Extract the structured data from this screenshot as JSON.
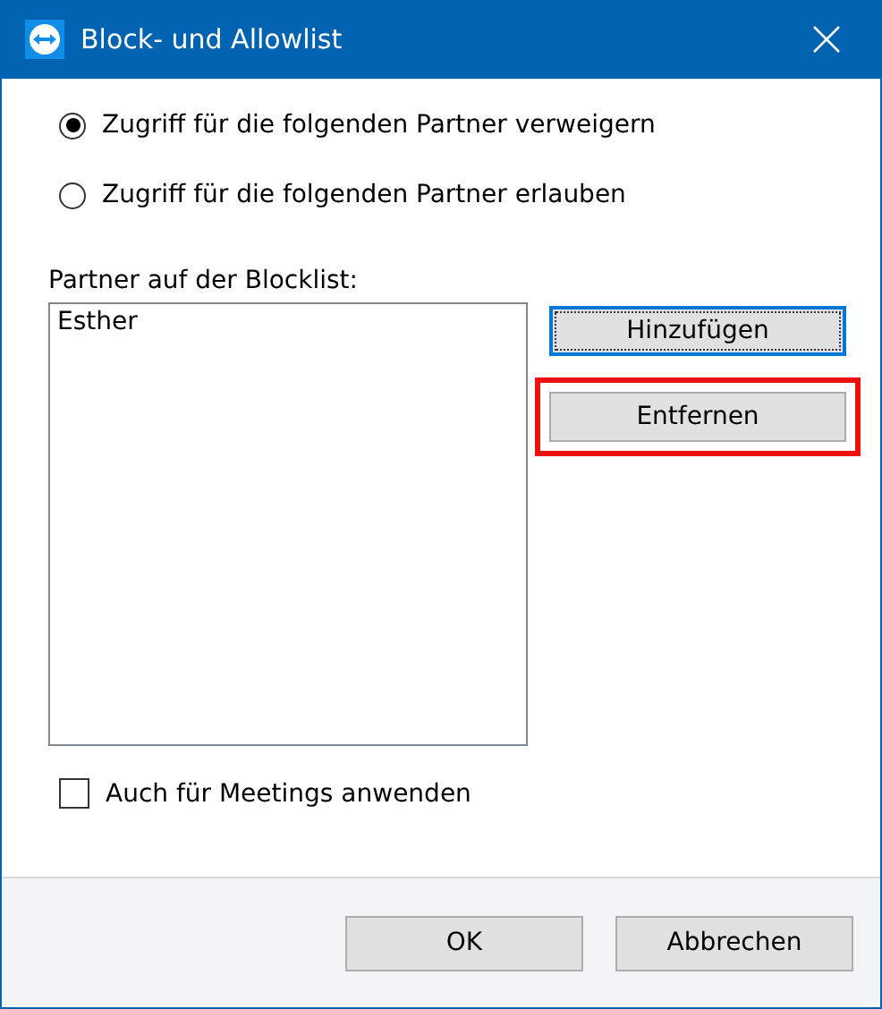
{
  "window": {
    "title": "Block- und Allowlist"
  },
  "radios": [
    {
      "label": "Zugriff für die folgenden Partner verweigern",
      "selected": true
    },
    {
      "label": "Zugriff für die folgenden Partner erlauben",
      "selected": false
    }
  ],
  "list": {
    "label": "Partner auf der Blocklist:",
    "items": [
      "Esther"
    ]
  },
  "side_buttons": [
    {
      "label": "Hinzufügen",
      "focused": true,
      "highlighted": false
    },
    {
      "label": "Entfernen",
      "focused": false,
      "highlighted": true
    }
  ],
  "checkbox": {
    "label": "Auch für Meetings anwenden",
    "checked": false
  },
  "footer_buttons": [
    "OK",
    "Abbrechen"
  ]
}
